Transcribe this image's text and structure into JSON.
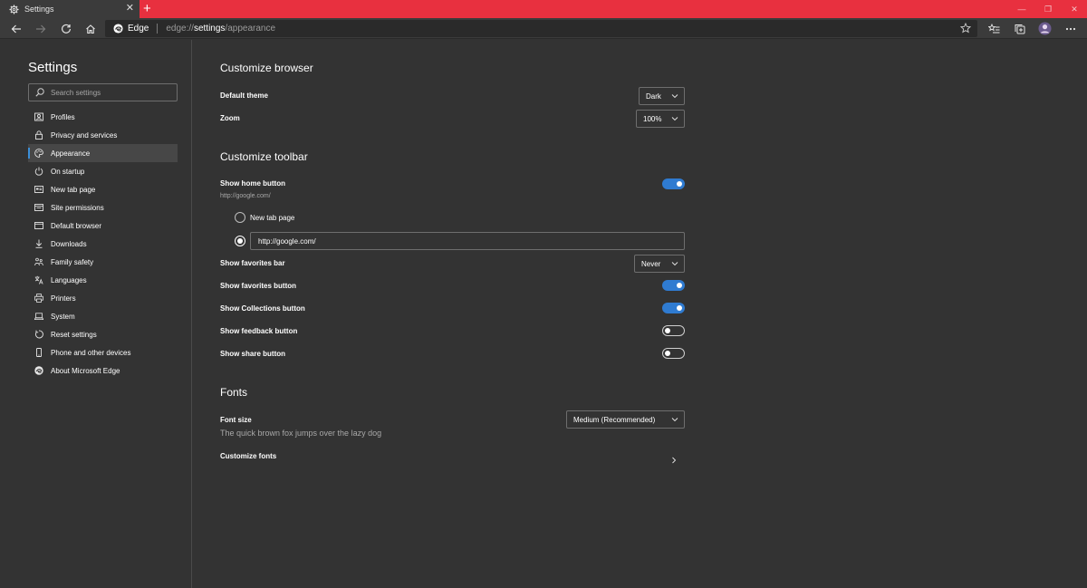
{
  "window": {
    "tab_title": "Settings",
    "tab_close": "✕",
    "new_tab": "+",
    "controls": {
      "minimize": "—",
      "restore": "❐",
      "close": "✕"
    }
  },
  "address_bar": {
    "site_label": "Edge",
    "url_scheme": "edge://",
    "url_host": "settings",
    "url_path": "/appearance"
  },
  "sidebar": {
    "title": "Settings",
    "search_placeholder": "Search settings",
    "items": [
      {
        "label": "Profiles",
        "icon": "profile-icon"
      },
      {
        "label": "Privacy and services",
        "icon": "lock-icon"
      },
      {
        "label": "Appearance",
        "icon": "palette-icon",
        "active": true
      },
      {
        "label": "On startup",
        "icon": "power-icon"
      },
      {
        "label": "New tab page",
        "icon": "new-tab-icon"
      },
      {
        "label": "Site permissions",
        "icon": "site-permissions-icon"
      },
      {
        "label": "Default browser",
        "icon": "browser-icon"
      },
      {
        "label": "Downloads",
        "icon": "download-icon"
      },
      {
        "label": "Family safety",
        "icon": "family-icon"
      },
      {
        "label": "Languages",
        "icon": "languages-icon"
      },
      {
        "label": "Printers",
        "icon": "printer-icon"
      },
      {
        "label": "System",
        "icon": "laptop-icon"
      },
      {
        "label": "Reset settings",
        "icon": "reset-icon"
      },
      {
        "label": "Phone and other devices",
        "icon": "phone-icon"
      },
      {
        "label": "About Microsoft Edge",
        "icon": "edge-icon"
      }
    ]
  },
  "main": {
    "customize_browser": {
      "title": "Customize browser",
      "default_theme_label": "Default theme",
      "default_theme_value": "Dark",
      "zoom_label": "Zoom",
      "zoom_value": "100%"
    },
    "customize_toolbar": {
      "title": "Customize toolbar",
      "home_button_label": "Show home button",
      "home_button_sub": "http://google.com/",
      "home_button_on": true,
      "radio_new_tab_label": "New tab page",
      "radio_url_value": "http://google.com/",
      "favorites_bar_label": "Show favorites bar",
      "favorites_bar_value": "Never",
      "favorites_button_label": "Show favorites button",
      "favorites_button_on": true,
      "collections_button_label": "Show Collections button",
      "collections_button_on": true,
      "feedback_button_label": "Show feedback button",
      "feedback_button_on": false,
      "share_button_label": "Show share button",
      "share_button_on": false
    },
    "fonts": {
      "title": "Fonts",
      "font_size_label": "Font size",
      "font_size_value": "Medium (Recommended)",
      "preview_text": "The quick brown fox jumps over the lazy dog",
      "customize_fonts_label": "Customize fonts"
    }
  },
  "colors": {
    "accent": "#e8303f",
    "toggle_on": "#2f7bd1",
    "background": "#333333"
  }
}
